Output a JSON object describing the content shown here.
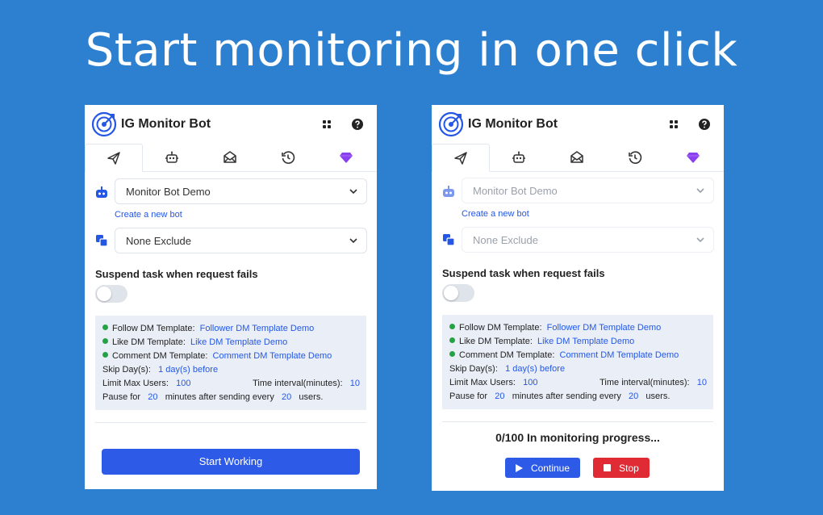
{
  "headline": "Start monitoring in one click",
  "colors": {
    "background": "#2d7fd0",
    "primary": "#2e5ae8",
    "link": "#2457e6",
    "success": "#25a244",
    "danger": "#e02b34",
    "premium": "#8a3ff0"
  },
  "app": {
    "title": "IG Monitor Bot"
  },
  "icons": {
    "logo": "target-icon",
    "grid": "grid-icon",
    "help": "help-icon"
  },
  "tabs": [
    {
      "name": "send",
      "icon": "paper-plane-icon",
      "active": true
    },
    {
      "name": "bot",
      "icon": "robot-icon",
      "active": false
    },
    {
      "name": "mail",
      "icon": "envelope-open-icon",
      "active": false
    },
    {
      "name": "history",
      "icon": "history-icon",
      "active": false
    },
    {
      "name": "premium",
      "icon": "diamond-icon",
      "active": false
    }
  ],
  "bot_select": {
    "value": "Monitor Bot Demo"
  },
  "create_bot_link": "Create a new bot",
  "exclude_select": {
    "value": "None Exclude"
  },
  "suspend": {
    "label": "Suspend task when request fails",
    "enabled": false
  },
  "templates": {
    "follow_label": "Follow DM Template:",
    "follow_value": "Follower DM Template Demo",
    "like_label": "Like DM Template:",
    "like_value": "Like DM Template Demo",
    "comment_label": "Comment DM Template:",
    "comment_value": "Comment DM Template Demo",
    "skip_label": "Skip Day(s):",
    "skip_value": "1 day(s) before",
    "limit_label": "Limit Max Users:",
    "limit_value": "100",
    "interval_label": "Time interval(minutes):",
    "interval_value": "10",
    "pause_prefix": "Pause for",
    "pause_minutes": "20",
    "pause_middle": "minutes after sending every",
    "pause_users": "20",
    "pause_suffix": "users."
  },
  "left": {
    "start_button": "Start Working"
  },
  "right": {
    "progress_text": "0/100 In monitoring progress...",
    "continue_button": "Continue",
    "stop_button": "Stop"
  }
}
